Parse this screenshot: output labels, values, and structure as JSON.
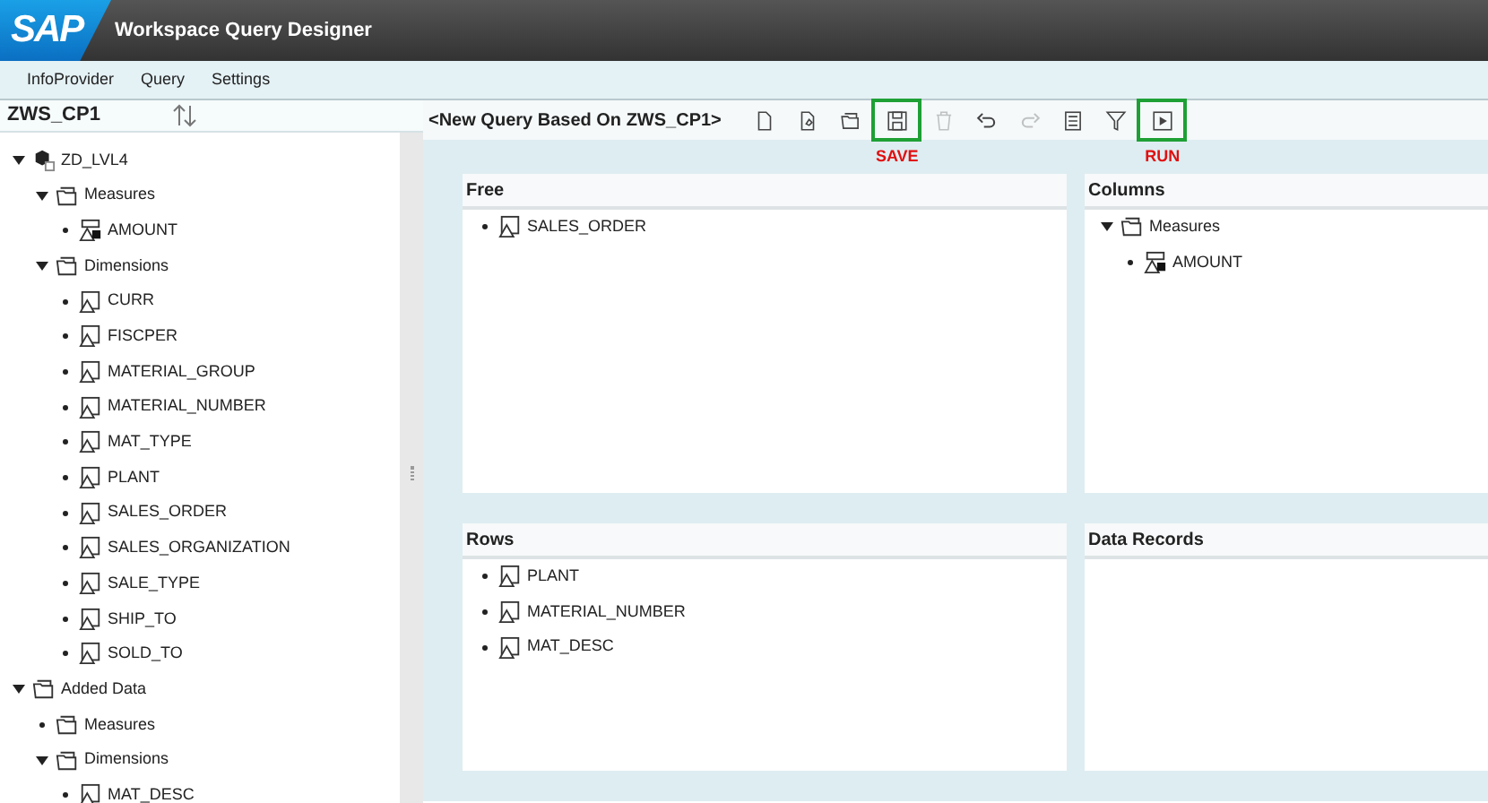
{
  "header": {
    "logo": "SAP",
    "title": "Workspace Query Designer"
  },
  "menu": [
    {
      "label": "InfoProvider"
    },
    {
      "label": "Query"
    },
    {
      "label": "Settings"
    }
  ],
  "sidebar": {
    "title": "ZWS_CP1",
    "tree": [
      {
        "label": "ZD_LVL4",
        "kind": "cube",
        "expanded": true,
        "children": [
          {
            "label": "Measures",
            "kind": "folder",
            "expanded": true,
            "children": [
              {
                "label": "AMOUNT",
                "kind": "measure",
                "expanded": false
              }
            ]
          },
          {
            "label": "Dimensions",
            "kind": "folder",
            "expanded": true,
            "children": [
              {
                "label": "CURR",
                "kind": "dimension",
                "expanded": false
              },
              {
                "label": "FISCPER",
                "kind": "dimension",
                "expanded": false
              },
              {
                "label": "MATERIAL_GROUP",
                "kind": "dimension",
                "expanded": false
              },
              {
                "label": "MATERIAL_NUMBER",
                "kind": "dimension",
                "expanded": false
              },
              {
                "label": "MAT_TYPE",
                "kind": "dimension",
                "expanded": false
              },
              {
                "label": "PLANT",
                "kind": "dimension",
                "expanded": false
              },
              {
                "label": "SALES_ORDER",
                "kind": "dimension",
                "expanded": false
              },
              {
                "label": "SALES_ORGANIZATION",
                "kind": "dimension",
                "expanded": false
              },
              {
                "label": "SALE_TYPE",
                "kind": "dimension",
                "expanded": false
              },
              {
                "label": "SHIP_TO",
                "kind": "dimension",
                "expanded": false
              },
              {
                "label": "SOLD_TO",
                "kind": "dimension",
                "expanded": false
              }
            ]
          }
        ]
      },
      {
        "label": "Added Data",
        "kind": "folder",
        "expanded": true,
        "children": [
          {
            "label": "Measures",
            "kind": "folder",
            "expanded": false
          },
          {
            "label": "Dimensions",
            "kind": "folder",
            "expanded": true,
            "children": [
              {
                "label": "MAT_DESC",
                "kind": "dimension",
                "expanded": false
              }
            ]
          }
        ]
      }
    ]
  },
  "query": {
    "title": "<New Query Based On ZWS_CP1>",
    "toolbar": [
      {
        "kind": "new",
        "disabled": false,
        "highlighted": false
      },
      {
        "kind": "edit",
        "disabled": false,
        "highlighted": false
      },
      {
        "kind": "open",
        "disabled": false,
        "highlighted": false
      },
      {
        "kind": "save",
        "disabled": false,
        "highlighted": true,
        "annotation": "SAVE"
      },
      {
        "kind": "delete",
        "disabled": true,
        "highlighted": false
      },
      {
        "kind": "undo",
        "disabled": false,
        "highlighted": false
      },
      {
        "kind": "redo",
        "disabled": true,
        "highlighted": false
      },
      {
        "kind": "list",
        "disabled": false,
        "highlighted": false
      },
      {
        "kind": "filter",
        "disabled": false,
        "highlighted": false
      },
      {
        "kind": "run",
        "disabled": false,
        "highlighted": true,
        "annotation": "RUN"
      }
    ]
  },
  "panels": [
    {
      "title": "Free",
      "tree": [
        {
          "label": "SALES_ORDER",
          "kind": "dimension",
          "expanded": false
        }
      ]
    },
    {
      "title": "Columns",
      "tree": [
        {
          "label": "Measures",
          "kind": "folder",
          "expanded": true,
          "children": [
            {
              "label": "AMOUNT",
              "kind": "measure",
              "expanded": false
            }
          ]
        }
      ]
    },
    {
      "title": "Rows",
      "tree": [
        {
          "label": "PLANT",
          "kind": "dimension",
          "expanded": false
        },
        {
          "label": "MATERIAL_NUMBER",
          "kind": "dimension",
          "expanded": false
        },
        {
          "label": "MAT_DESC",
          "kind": "dimension",
          "expanded": false
        }
      ]
    },
    {
      "title": "Data Records"
    }
  ]
}
